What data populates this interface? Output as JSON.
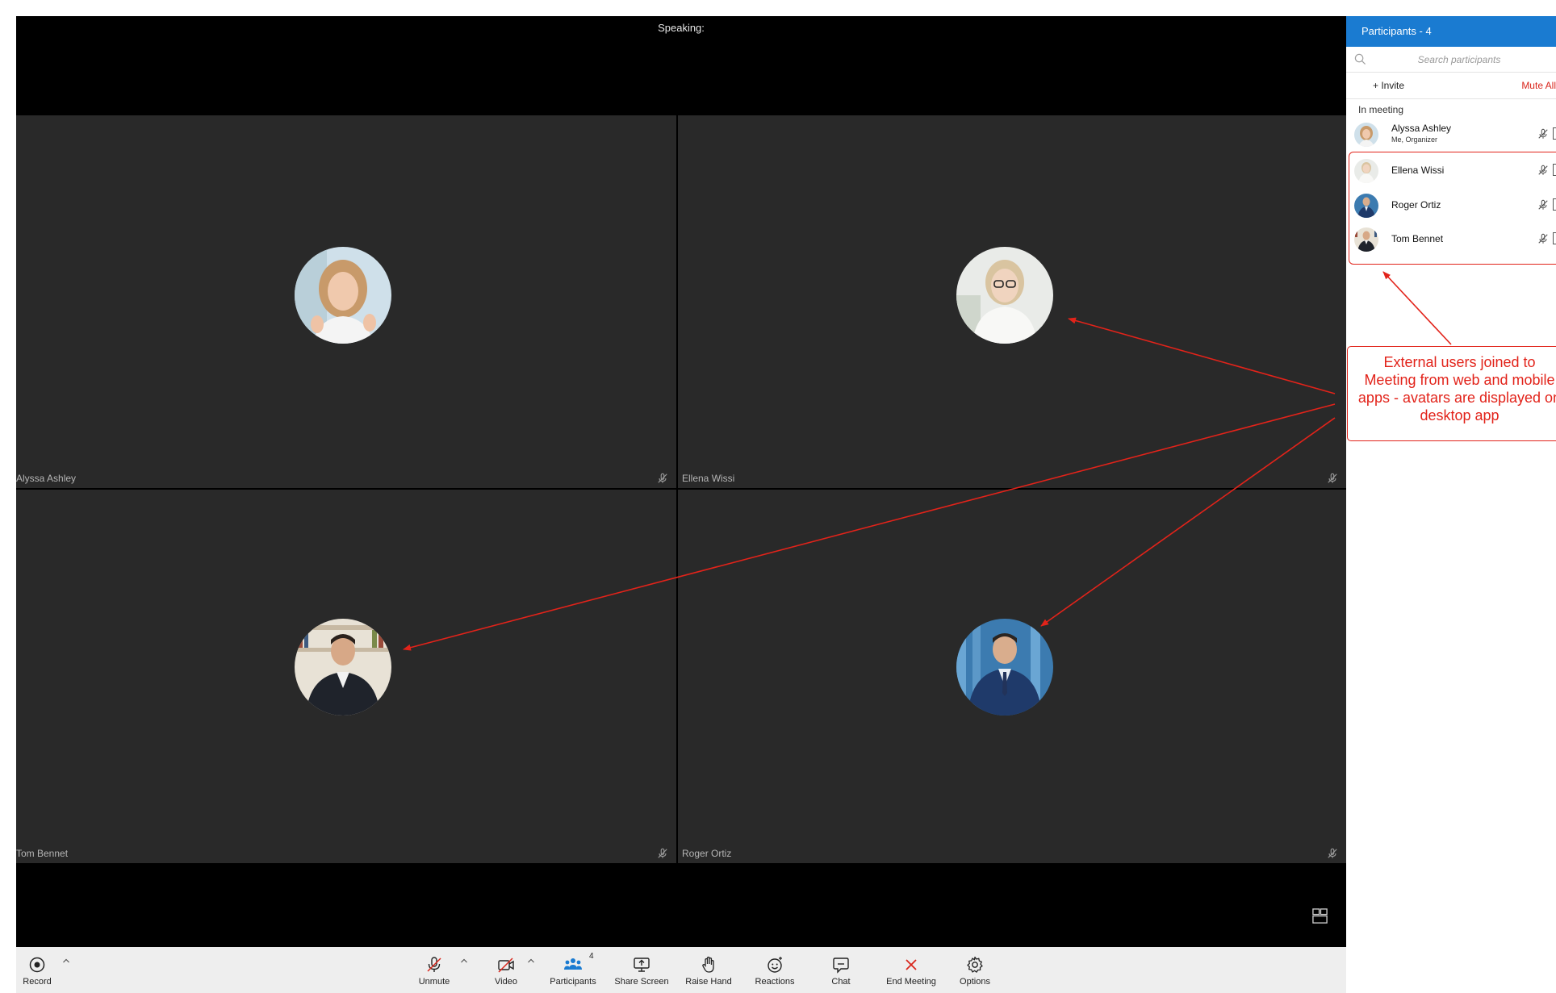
{
  "meeting": {
    "speaking_label": "Speaking:"
  },
  "tiles": [
    {
      "name": "Alyssa Ashley"
    },
    {
      "name": "Ellena Wissi"
    },
    {
      "name": "Tom Bennet"
    },
    {
      "name": "Roger Ortiz"
    }
  ],
  "toolbar": {
    "record": "Record",
    "unmute": "Unmute",
    "video": "Video",
    "participants": "Participants",
    "participants_count": "4",
    "share_screen": "Share Screen",
    "raise_hand": "Raise Hand",
    "reactions": "Reactions",
    "chat": "Chat",
    "end_meeting": "End Meeting",
    "options": "Options"
  },
  "panel": {
    "title": "Participants - 4",
    "search_placeholder": "Search participants",
    "invite": "+ Invite",
    "mute_all": "Mute All",
    "section_label": "In meeting",
    "participants": [
      {
        "name": "Alyssa Ashley",
        "role": "Me, Organizer"
      },
      {
        "name": "Ellena Wissi"
      },
      {
        "name": "Roger Ortiz"
      },
      {
        "name": "Tom Bennet"
      }
    ]
  },
  "annotation": {
    "text": "External users joined to Meeting from web and mobile apps - avatars are displayed on desktop app"
  },
  "colors": {
    "panel_header": "#1a7bd1",
    "tile_background": "#292929",
    "annotation": "#e2231a",
    "end_meeting": "#d9261c"
  }
}
